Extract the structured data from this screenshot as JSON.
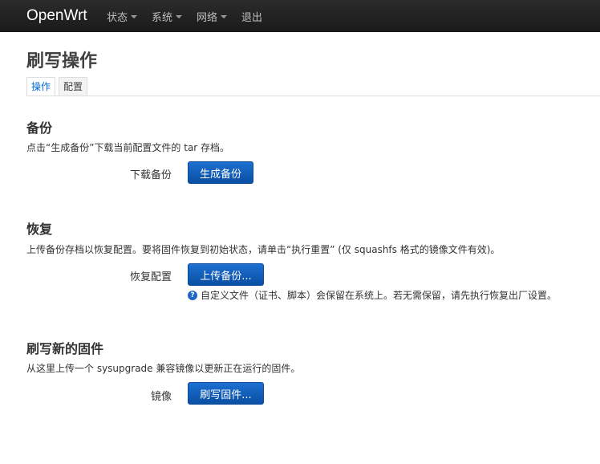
{
  "navbar": {
    "brand": "OpenWrt",
    "menu": [
      {
        "label": "状态",
        "has_dropdown": true
      },
      {
        "label": "系统",
        "has_dropdown": true
      },
      {
        "label": "网络",
        "has_dropdown": true
      },
      {
        "label": "退出",
        "has_dropdown": false
      }
    ]
  },
  "page": {
    "title": "刷写操作",
    "tabs": [
      {
        "label": "操作",
        "active": true
      },
      {
        "label": "配置",
        "active": false
      }
    ]
  },
  "backup": {
    "title": "备份",
    "description": "点击“生成备份”下载当前配置文件的 tar 存档。",
    "field_label": "下载备份",
    "button_label": "生成备份"
  },
  "restore": {
    "title": "恢复",
    "description": "上传备份存档以恢复配置。要将固件恢复到初始状态，请单击“执行重置” (仅 squashfs 格式的镜像文件有效)。",
    "field_label": "恢复配置",
    "button_label": "上传备份...",
    "hint": "自定义文件（证书、脚本）会保留在系统上。若无需保留，请先执行恢复出厂设置。",
    "hint_icon": "question-circle-icon"
  },
  "flash": {
    "title": "刷写新的固件",
    "description": "从这里上传一个 sysupgrade 兼容镜像以更新正在运行的固件。",
    "field_label": "镜像",
    "button_label": "刷写固件..."
  },
  "colors": {
    "navbar_bg": "#1f1f1f",
    "button_bg": "#0d57b0",
    "active_tab": "#0069d6"
  }
}
